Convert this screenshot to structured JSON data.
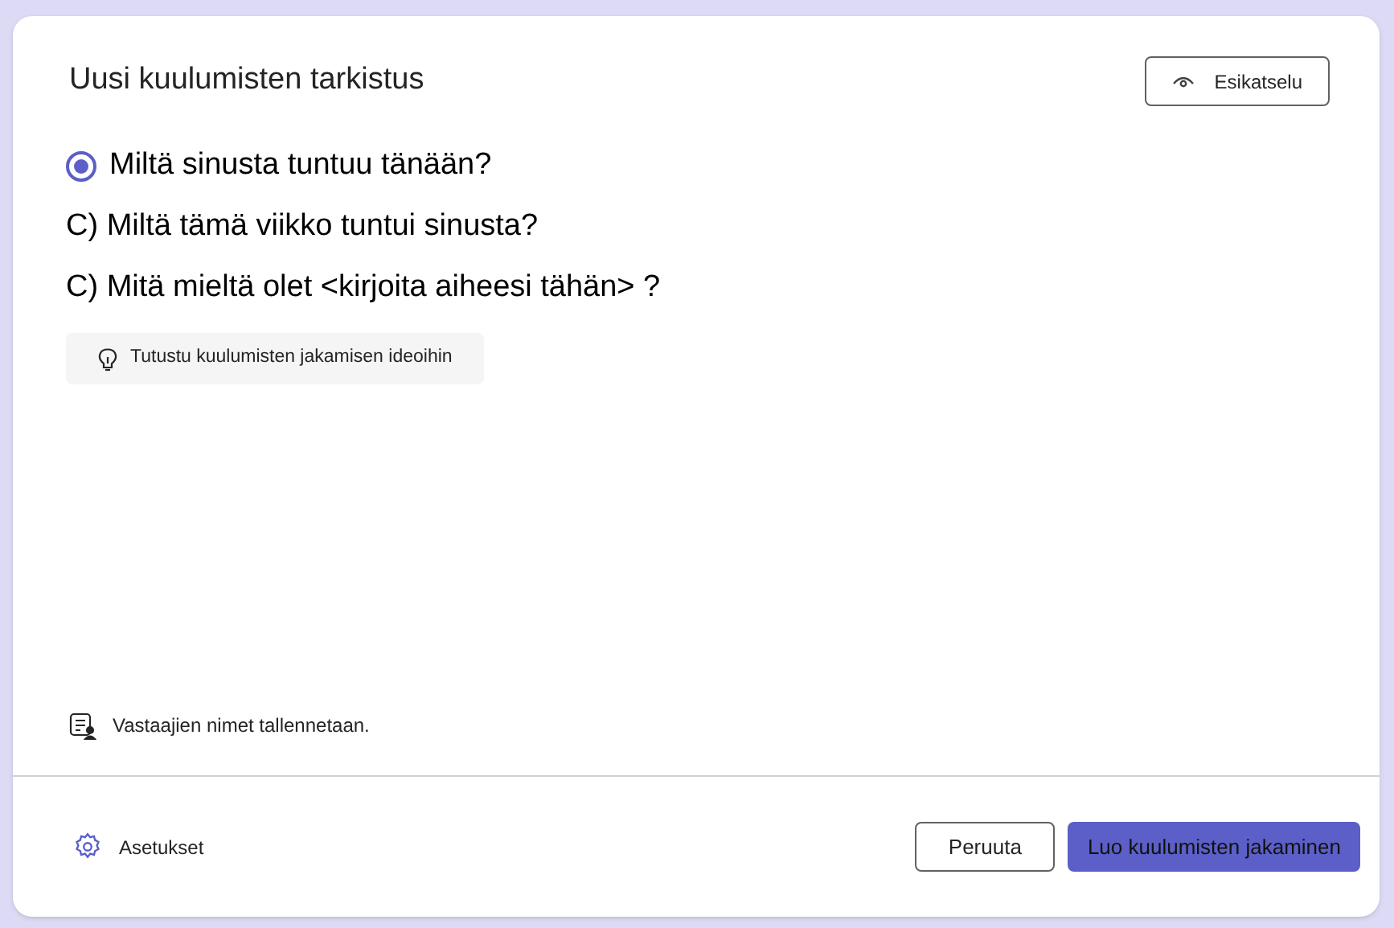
{
  "dialog": {
    "title": "Uusi kuulumisten tarkistus",
    "preview_button": "Esikatselu"
  },
  "questions": [
    {
      "kind": "radio",
      "text": "Miltä sinusta tuntuu tänään?",
      "selected": true
    },
    {
      "kind": "text",
      "text": "C) Miltä tämä viikko tuntui sinusta?"
    },
    {
      "kind": "text",
      "text": "C) Mitä mieltä olet <kirjoita aiheesi tähän> ?"
    }
  ],
  "ideas_button": "Tutustu kuulumisten jakamisen ideoihin",
  "info": "Vastaajien nimet tallennetaan.",
  "footer": {
    "settings": "Asetukset",
    "cancel": "Peruuta",
    "create": "Luo kuulumisten jakaminen"
  }
}
